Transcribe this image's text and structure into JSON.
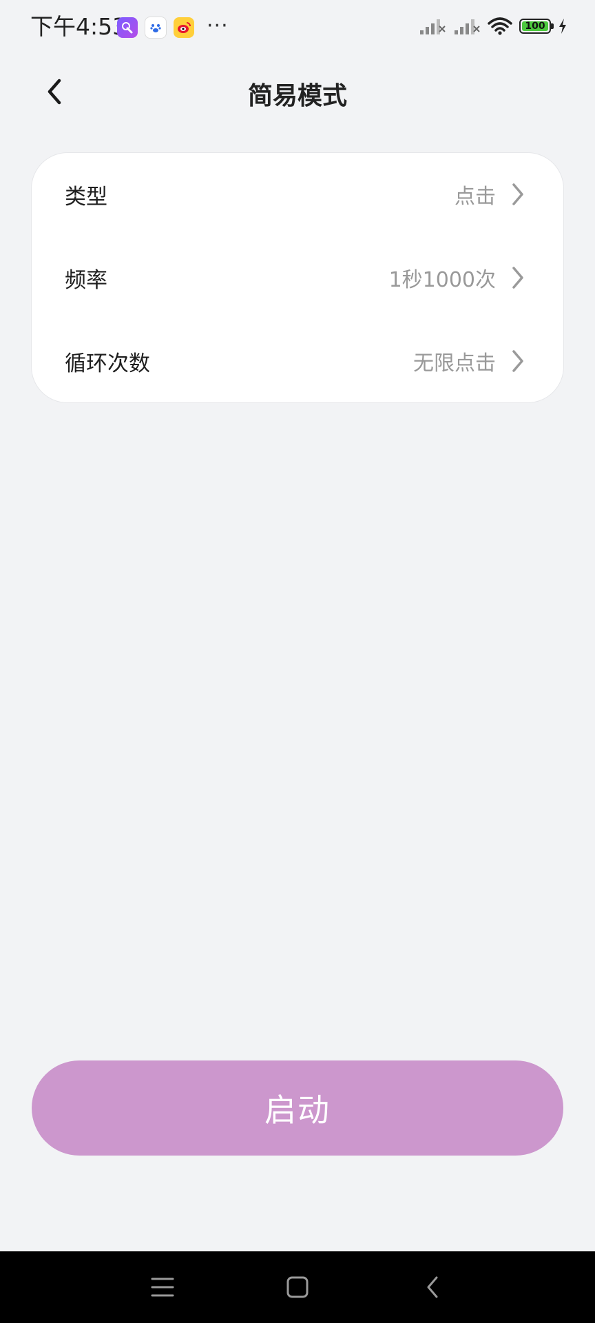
{
  "status_bar": {
    "time": "下午4:53",
    "more": "···",
    "battery": "100"
  },
  "header": {
    "title": "简易模式"
  },
  "settings": [
    {
      "label": "类型",
      "value": "点击"
    },
    {
      "label": "频率",
      "value": "1秒1000次"
    },
    {
      "label": "循环次数",
      "value": "无限点击"
    }
  ],
  "start_button": {
    "label": "启动"
  },
  "colors": {
    "background": "#f2f3f5",
    "accent": "#cc97cd",
    "value_text": "#999999"
  }
}
